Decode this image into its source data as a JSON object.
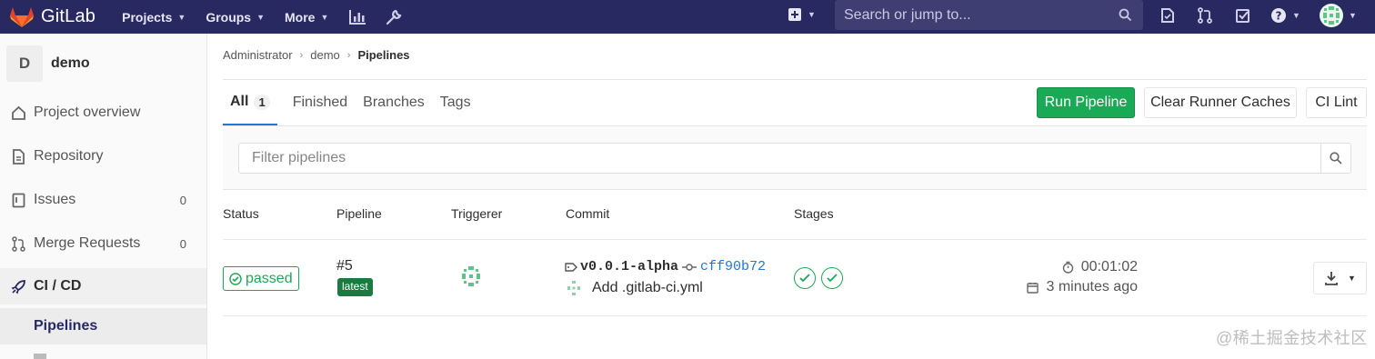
{
  "topbar": {
    "brand": "GitLab",
    "menus": [
      {
        "label": "Projects"
      },
      {
        "label": "Groups"
      },
      {
        "label": "More"
      }
    ],
    "search_placeholder": "Search or jump to...",
    "icons": [
      "activity-chart-icon",
      "admin-wrench-icon",
      "plus-square-icon",
      "todo-icon",
      "merge-request-icon",
      "issues-check-icon",
      "help-icon",
      "user-avatar"
    ]
  },
  "sidebar": {
    "project_initial": "D",
    "project_name": "demo",
    "items": [
      {
        "label": "Project overview",
        "icon": "home-icon"
      },
      {
        "label": "Repository",
        "icon": "doc-icon"
      },
      {
        "label": "Issues",
        "icon": "issues-icon",
        "count": "0"
      },
      {
        "label": "Merge Requests",
        "icon": "merge-request-icon",
        "count": "0"
      },
      {
        "label": "CI / CD",
        "icon": "rocket-icon"
      }
    ],
    "active_sub": "Pipelines"
  },
  "breadcrumb": [
    "Administrator",
    "demo",
    "Pipelines"
  ],
  "tabs": [
    {
      "label": "All",
      "count": "1"
    },
    {
      "label": "Finished"
    },
    {
      "label": "Branches"
    },
    {
      "label": "Tags"
    }
  ],
  "buttons": {
    "run_pipeline": "Run Pipeline",
    "clear_caches": "Clear Runner Caches",
    "ci_lint": "CI Lint"
  },
  "filter": {
    "placeholder": "Filter pipelines"
  },
  "table": {
    "headers": [
      "Status",
      "Pipeline",
      "Triggerer",
      "Commit",
      "Stages"
    ],
    "rows": [
      {
        "status": "passed",
        "pipeline_id": "#5",
        "pipeline_badge": "latest",
        "ref": "v0.0.1-alpha",
        "sha": "cff90b72",
        "commit_message": "Add .gitlab-ci.yml",
        "stages": [
          "passed",
          "passed"
        ],
        "duration": "00:01:02",
        "finished": "3 minutes ago"
      }
    ]
  },
  "watermark": "@稀土掘金技术社区",
  "colors": {
    "navbar": "#292961",
    "success": "#1aaa55",
    "link": "#1f78d1"
  }
}
